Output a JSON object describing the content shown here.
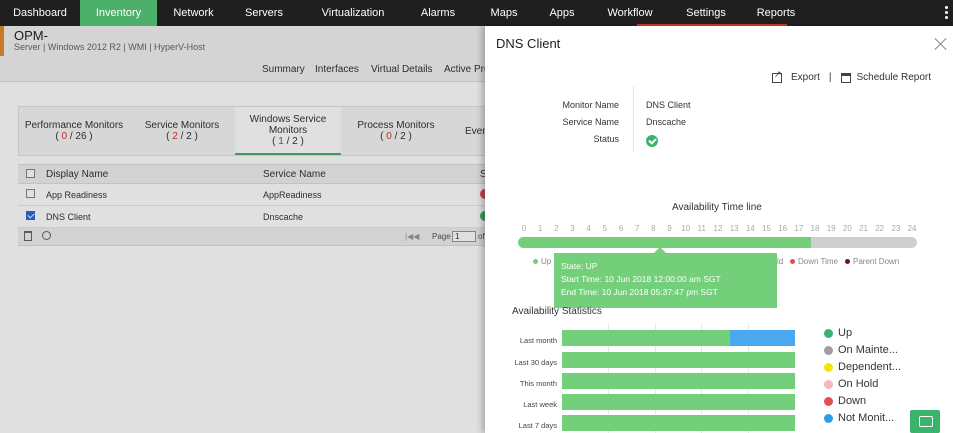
{
  "nav": {
    "items": [
      "Dashboard",
      "Inventory",
      "Network",
      "Servers",
      "Virtualization",
      "Alarms",
      "Maps",
      "Apps",
      "Workflow",
      "Settings",
      "Reports"
    ],
    "active_index": 1,
    "accent": "#4caf6a"
  },
  "monitor": {
    "title": "OPM-",
    "subtitle": "Server | Windows 2012 R2 | WMI | HyperV-Host"
  },
  "subtabs": [
    "Summary",
    "Interfaces",
    "Virtual Details",
    "Active Pro"
  ],
  "categories": [
    {
      "name": "Performance Monitors",
      "count_red": "0",
      "count_total": "26"
    },
    {
      "name": "Service Monitors",
      "count_red": "2",
      "count_total": "2"
    },
    {
      "name": "Windows Service Monitors",
      "count_red": "1",
      "count_total": "2"
    },
    {
      "name": "Process Monitors",
      "count_red": "0",
      "count_total": "2"
    },
    {
      "name": "Even",
      "count_red": "",
      "count_total": ""
    }
  ],
  "table": {
    "headers": [
      "Display Name",
      "Service Name",
      "S"
    ],
    "rows": [
      {
        "display": "App Readiness",
        "service": "AppReadiness",
        "checked": false,
        "status_color": "#e05050"
      },
      {
        "display": "DNS Client",
        "service": "Dnscache",
        "checked": true,
        "status_color": "#3bb36a"
      }
    ],
    "footer": {
      "page_label": "Page",
      "page_value": "1",
      "of_label": "of"
    }
  },
  "drawer": {
    "title": "DNS Client",
    "export_label": "Export",
    "separator": "|",
    "schedule_label": "Schedule Report",
    "info": [
      {
        "label": "Monitor Name",
        "value": "DNS Client"
      },
      {
        "label": "Service Name",
        "value": "Dnscache"
      },
      {
        "label": "Status",
        "value": ""
      }
    ],
    "timeline_title": "Availability Time line",
    "hours": [
      "0",
      "1",
      "2",
      "3",
      "4",
      "5",
      "6",
      "7",
      "8",
      "9",
      "10",
      "11",
      "12",
      "13",
      "14",
      "15",
      "16",
      "17",
      "18",
      "19",
      "20",
      "21",
      "22",
      "23",
      "24"
    ],
    "timeline_up_until_hour": 17.6,
    "timeline_legend": [
      {
        "label": "Up",
        "color": "#74cf7b"
      },
      {
        "label": "ld",
        "color": ""
      },
      {
        "label": "Down Time",
        "color": "#e05050"
      },
      {
        "label": "Parent Down",
        "color": "#7a1010"
      }
    ],
    "tooltip": {
      "line1": "State: UP",
      "line2": "Start Time: 10 Jun 2018 12:00:00 am SGT",
      "line3": "End Time: 10 Jun 2018 05:37:47 pm SGT"
    },
    "stats_title": "Availability Statistics",
    "stats_rows": [
      {
        "label": "Last month",
        "up": 0.72,
        "not_monitored": 0.28
      },
      {
        "label": "Last 30 days",
        "up": 1.0,
        "not_monitored": 0
      },
      {
        "label": "This month",
        "up": 1.0,
        "not_monitored": 0
      },
      {
        "label": "Last week",
        "up": 1.0,
        "not_monitored": 0
      },
      {
        "label": "Last 7 days",
        "up": 1.0,
        "not_monitored": 0
      }
    ],
    "stats_legend": [
      {
        "label": "Up",
        "color": "#3bb36a"
      },
      {
        "label": "On Mainte...",
        "color": "#9e9e9e"
      },
      {
        "label": "Dependent...",
        "color": "#f2e600"
      },
      {
        "label": "On Hold",
        "color": "#f7b6c2"
      },
      {
        "label": "Down",
        "color": "#e05050"
      },
      {
        "label": "Not Monit...",
        "color": "#2f9ce8"
      }
    ]
  }
}
